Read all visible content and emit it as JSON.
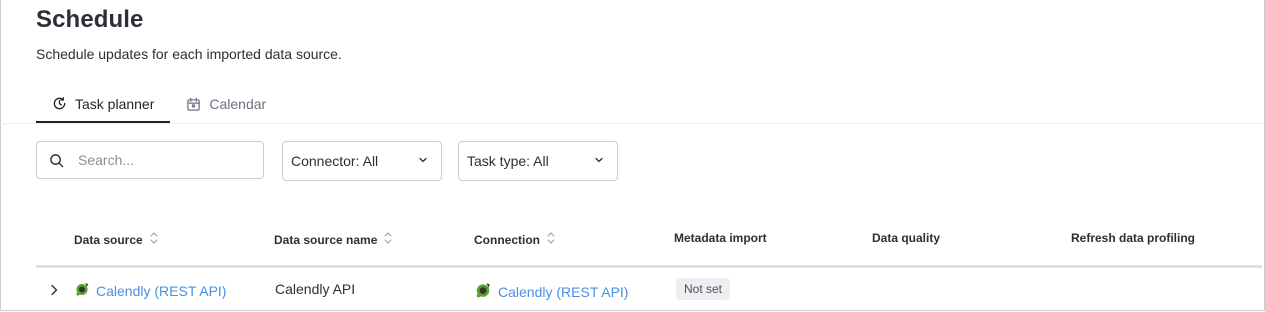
{
  "page": {
    "title": "Schedule",
    "subtitle": "Schedule updates for each imported data source."
  },
  "tabs": [
    {
      "label": "Task planner",
      "icon": "clock-refresh-icon",
      "active": true
    },
    {
      "label": "Calendar",
      "icon": "calendar-icon",
      "active": false
    }
  ],
  "filters": {
    "search_placeholder": "Search...",
    "search_value": "",
    "connector_label": "Connector: All",
    "task_type_label": "Task type: All"
  },
  "table": {
    "columns": [
      {
        "label": "Data source",
        "sortable": true
      },
      {
        "label": "Data source name",
        "sortable": true
      },
      {
        "label": "Connection",
        "sortable": true
      },
      {
        "label": "Metadata import",
        "sortable": false
      },
      {
        "label": "Data quality",
        "sortable": false
      },
      {
        "label": "Refresh data profiling",
        "sortable": false
      }
    ],
    "rows": [
      {
        "data_source": "Calendly (REST API)",
        "data_source_name": "Calendly API",
        "connection": "Calendly (REST API)",
        "metadata_import": "Not set",
        "data_quality": "",
        "refresh_data_profiling": ""
      }
    ]
  },
  "colors": {
    "link": "#4a8fe0",
    "border": "#c9ccd1",
    "badge_bg": "#eceef1"
  }
}
